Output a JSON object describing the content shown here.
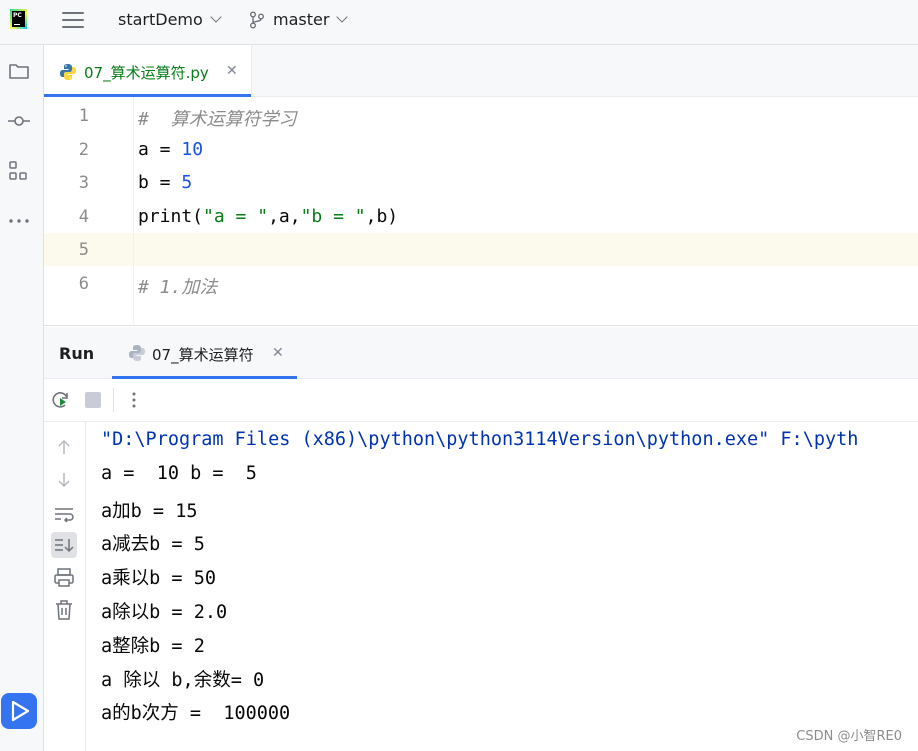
{
  "topbar": {
    "logo_text": "PC",
    "project": "startDemo",
    "branch": "master"
  },
  "left_strip": {
    "icons": [
      "folder-icon",
      "commit-icon",
      "structure-icon",
      "more-icon",
      "run-icon"
    ]
  },
  "editor": {
    "file_tab": "07_算术运算符.py",
    "lines": [
      {
        "n": "1",
        "code": [
          {
            "t": "#  算术运算符学习",
            "c": "comment"
          }
        ]
      },
      {
        "n": "2",
        "code": [
          {
            "t": "a = ",
            "c": "plain"
          },
          {
            "t": "10",
            "c": "num"
          }
        ]
      },
      {
        "n": "3",
        "code": [
          {
            "t": "b = ",
            "c": "plain"
          },
          {
            "t": "5",
            "c": "num"
          }
        ]
      },
      {
        "n": "4",
        "code": [
          {
            "t": "print(",
            "c": "plain"
          },
          {
            "t": "\"a = \"",
            "c": "str"
          },
          {
            "t": ",a,",
            "c": "plain"
          },
          {
            "t": "\"b = \"",
            "c": "str"
          },
          {
            "t": ",b)",
            "c": "plain"
          }
        ]
      },
      {
        "n": "5",
        "code": []
      },
      {
        "n": "6",
        "code": [
          {
            "t": "# 1.加法",
            "c": "comment"
          }
        ]
      }
    ]
  },
  "run": {
    "title": "Run",
    "tab_label": "07_算术运算符",
    "output": [
      "\"D:\\Program Files (x86)\\python\\python3114Version\\python.exe\" F:\\pyth",
      "a =  10 b =  5",
      "a加b = 15",
      "a减去b = 5",
      "a乘以b = 50",
      "a除以b = 2.0",
      "a整除b = 2",
      "a 除以 b,余数= 0",
      "a的b次方 =  100000"
    ]
  },
  "watermark": "CSDN @小智RE0",
  "colors": {
    "accent": "#3574f0",
    "string": "#067d17",
    "number": "#1750eb",
    "comment": "#8c8c8c",
    "command": "#0033b3"
  }
}
